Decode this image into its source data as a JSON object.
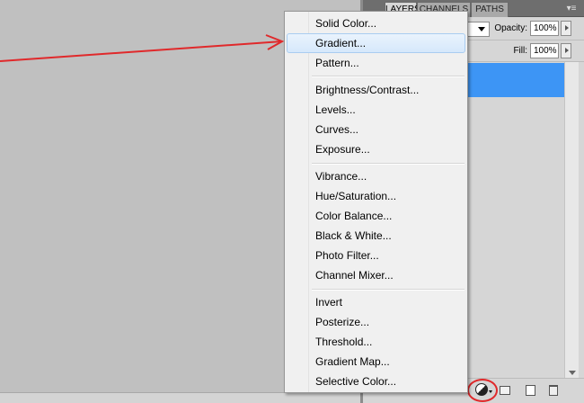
{
  "panel": {
    "tabs": [
      {
        "label": "LAYERS",
        "active": true
      },
      {
        "label": "CHANNELS",
        "active": false
      },
      {
        "label": "PATHS",
        "active": false
      }
    ],
    "menu_icon": "panel-menu-icon",
    "opacity_label": "Opacity:",
    "opacity_value": "100%",
    "fill_label": "Fill:",
    "fill_value": "100%"
  },
  "adjustment_menu": {
    "groups": [
      [
        "Solid Color...",
        "Gradient...",
        "Pattern..."
      ],
      [
        "Brightness/Contrast...",
        "Levels...",
        "Curves...",
        "Exposure..."
      ],
      [
        "Vibrance...",
        "Hue/Saturation...",
        "Color Balance...",
        "Black & White...",
        "Photo Filter...",
        "Channel Mixer..."
      ],
      [
        "Invert",
        "Posterize...",
        "Threshold...",
        "Gradient Map...",
        "Selective Color..."
      ]
    ],
    "hovered_item": "Gradient..."
  },
  "colors": {
    "annotation_red": "#e0292b",
    "selection_blue": "#3d95f5",
    "canvas_gray": "#c0c0c0"
  }
}
